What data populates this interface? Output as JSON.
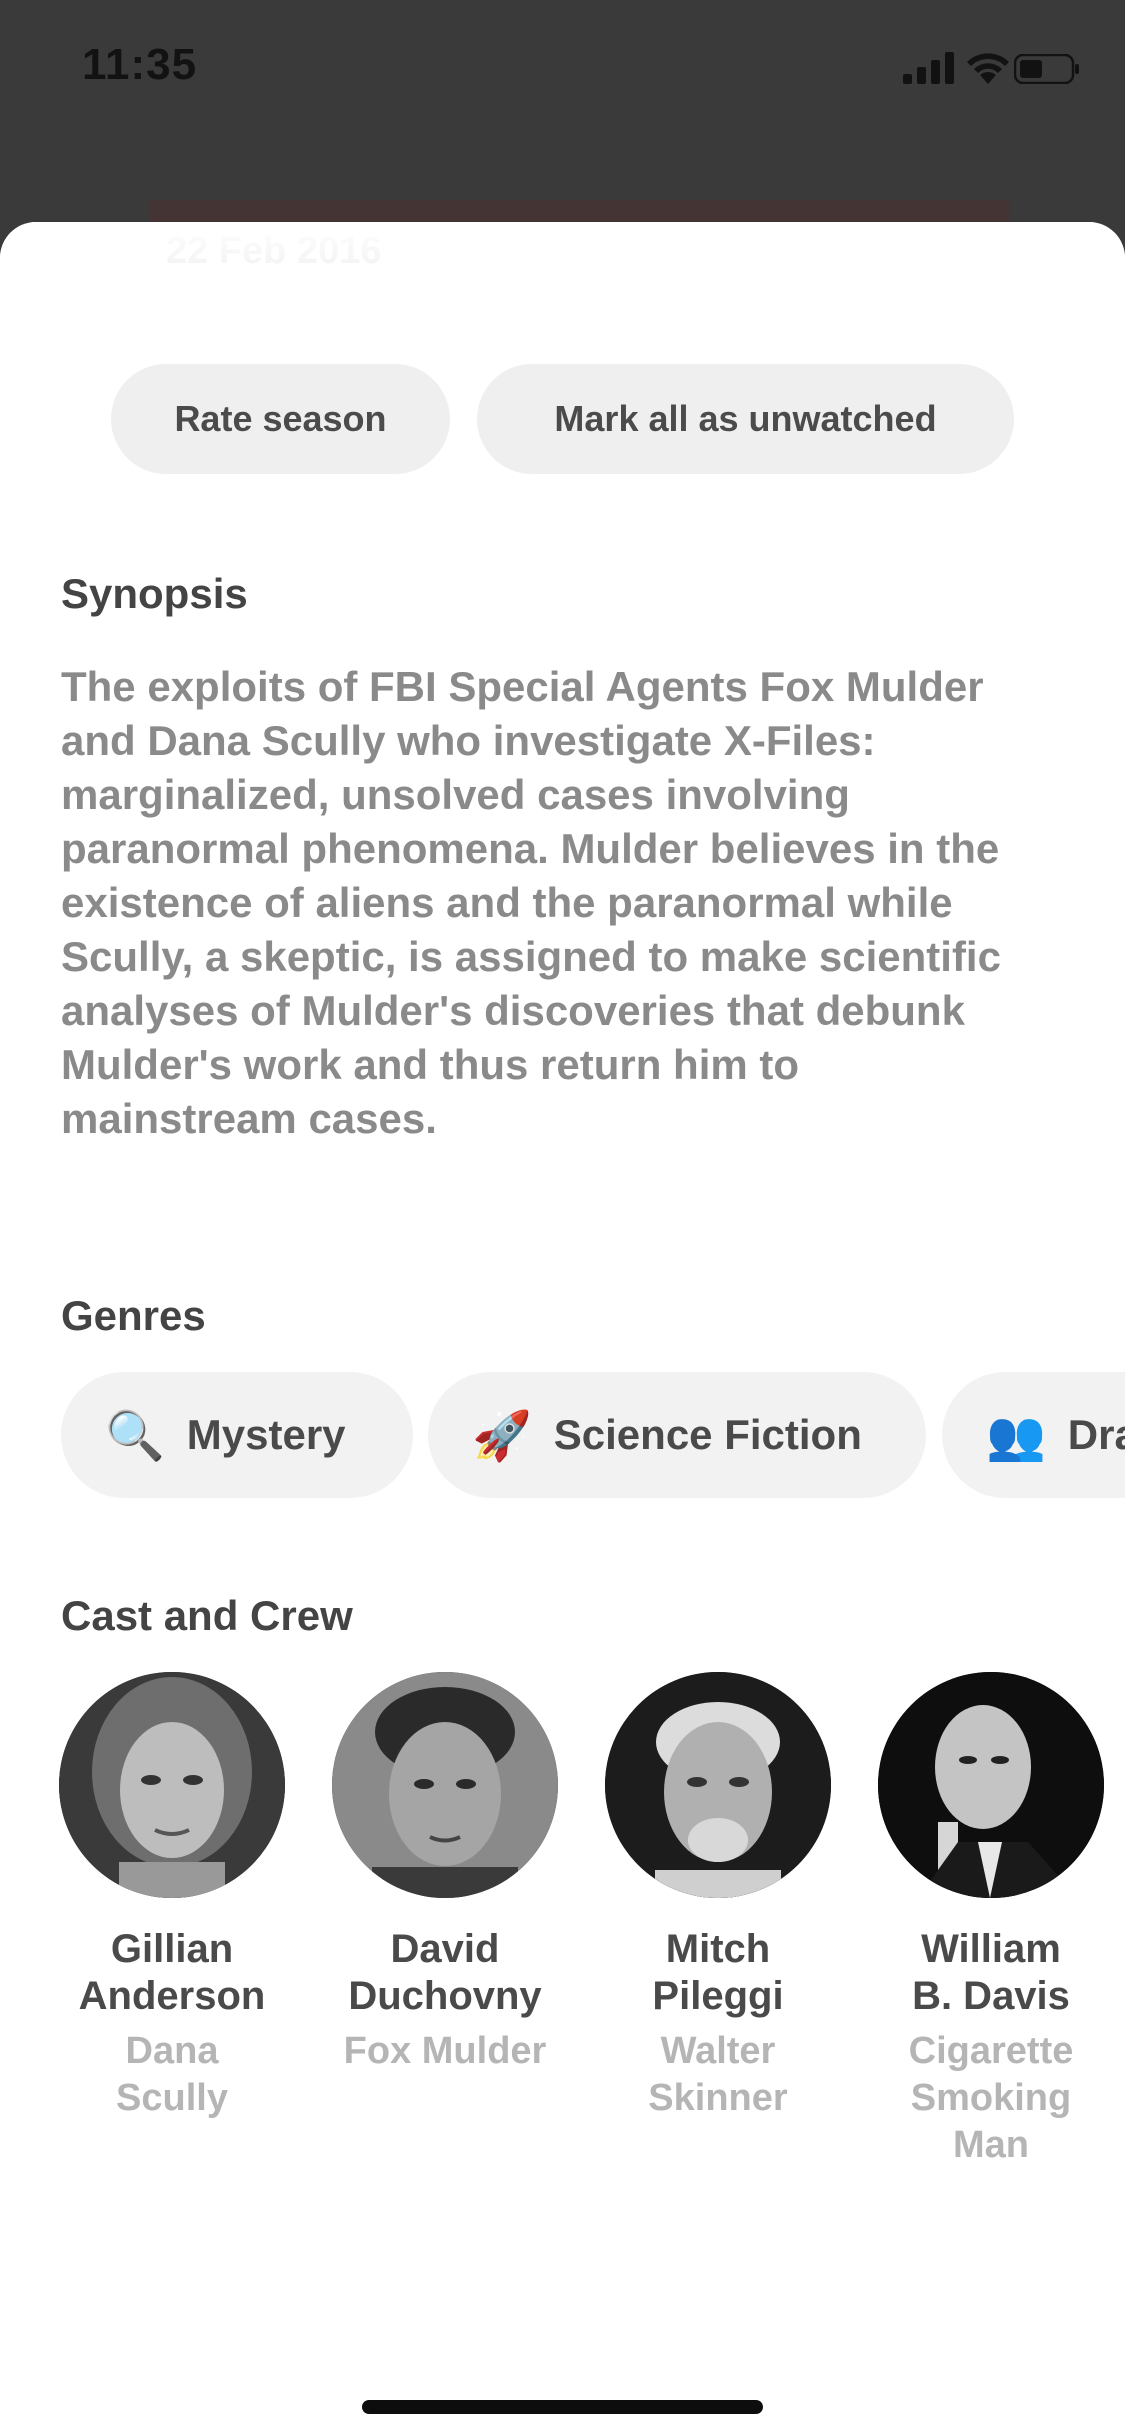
{
  "status_bar": {
    "time": "11:35"
  },
  "header": {
    "air_date": "22 Feb 2016"
  },
  "actions": {
    "rate_label": "Rate season",
    "mark_label": "Mark all as unwatched"
  },
  "synopsis": {
    "title": "Synopsis",
    "text": "The exploits of FBI Special Agents Fox Mulder and Dana Scully who investigate X-Files: marginalized, unsolved cases involving paranormal phenomena. Mulder believes in the existence of aliens and the paranormal while Scully, a skeptic, is assigned to make scientific analyses of Mulder's discoveries that debunk Mulder's work and thus return him to mainstream cases."
  },
  "genres": {
    "title": "Genres",
    "items": [
      {
        "icon": "magnifying-glass-icon",
        "emoji": "🔍",
        "label": "Mystery"
      },
      {
        "icon": "rocket-icon",
        "emoji": "🚀",
        "label": "Science Fiction"
      },
      {
        "icon": "people-icon",
        "emoji": "👥",
        "label": "Drama"
      }
    ]
  },
  "cast": {
    "title": "Cast and Crew",
    "members": [
      {
        "name_line1": "Gillian",
        "name_line2": "Anderson",
        "role_line1": "Dana",
        "role_line2": "Scully",
        "role_line3": ""
      },
      {
        "name_line1": "David",
        "name_line2": "Duchovny",
        "role_line1": "Fox Mulder",
        "role_line2": "",
        "role_line3": ""
      },
      {
        "name_line1": "Mitch",
        "name_line2": "Pileggi",
        "role_line1": "Walter",
        "role_line2": "Skinner",
        "role_line3": ""
      },
      {
        "name_line1": "William",
        "name_line2": "B. Davis",
        "role_line1": "Cigarette",
        "role_line2": "Smoking",
        "role_line3": "Man"
      }
    ]
  },
  "colors": {
    "chip_background": "#efefef",
    "title_text": "#444444",
    "body_text": "#8a8a8a",
    "muted_text": "#b5b5b5"
  }
}
